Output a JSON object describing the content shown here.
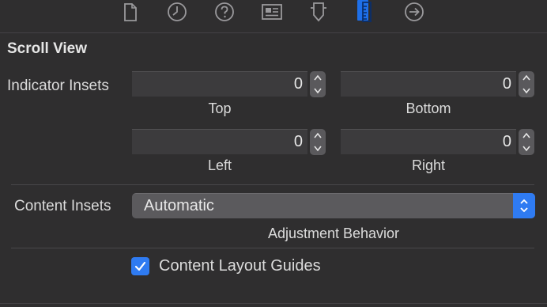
{
  "toolbar": {
    "icons": [
      "file-inspector-icon",
      "history-icon",
      "quick-help-icon",
      "identity-icon",
      "attributes-icon",
      "size-inspector-icon",
      "connections-icon"
    ],
    "active": "size-inspector-icon",
    "accent": "#1e6fe8"
  },
  "section": {
    "title": "Scroll View"
  },
  "indicator_insets": {
    "label": "Indicator Insets",
    "top": {
      "value": "0",
      "label": "Top"
    },
    "bottom": {
      "value": "0",
      "label": "Bottom"
    },
    "left": {
      "value": "0",
      "label": "Left"
    },
    "right": {
      "value": "0",
      "label": "Right"
    }
  },
  "content_insets": {
    "label": "Content Insets",
    "value": "Automatic",
    "sublabel": "Adjustment Behavior"
  },
  "layout_guides": {
    "label": "Content Layout Guides",
    "checked": true
  },
  "colors": {
    "background": "#2f2e2f",
    "accent": "#2f7bf2"
  }
}
